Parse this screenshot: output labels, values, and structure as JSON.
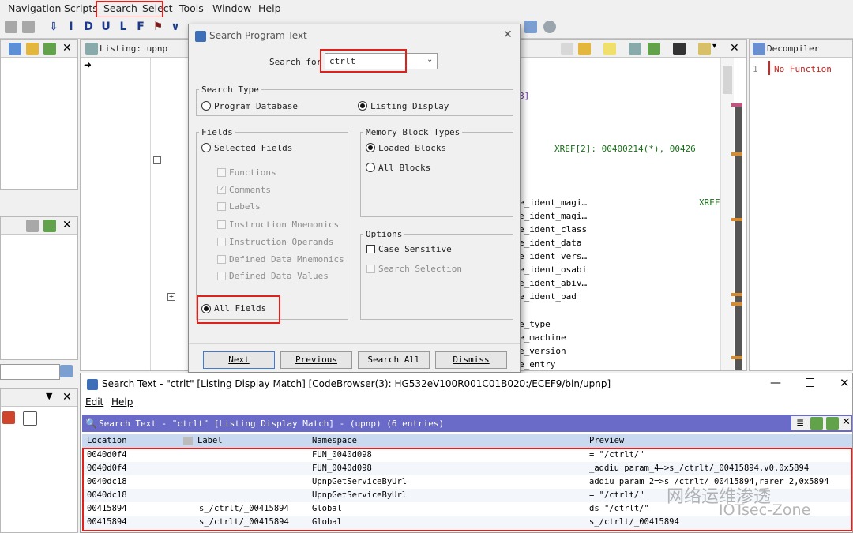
{
  "menu": {
    "items": [
      "Navigation",
      "Scripts",
      "Search",
      "Select",
      "Tools",
      "Window",
      "Help"
    ]
  },
  "toolbar": {
    "letters": [
      "I",
      "D",
      "U",
      "L",
      "F"
    ]
  },
  "listing": {
    "title": "Listing:  upnp",
    "lines": [
      {
        "text": "8]"
      },
      {
        "text": "XREF[2]:     00400214(*), 00426"
      },
      {
        "text": "e_ident_magi…"
      },
      {
        "text": "XREF"
      },
      {
        "text": "e_ident_magi…"
      },
      {
        "text": "e_ident_class"
      },
      {
        "text": "e_ident_data"
      },
      {
        "text": "e_ident_vers…"
      },
      {
        "text": "e_ident_osabi"
      },
      {
        "text": "e_ident_abiv…"
      },
      {
        "text": "e_ident_pad"
      },
      {
        "text": "e_type"
      },
      {
        "text": "e_machine"
      },
      {
        "text": "e_version"
      },
      {
        "text": "e_entry"
      }
    ]
  },
  "decompiler": {
    "title": "Decompiler",
    "line_no": "1",
    "text": "No Function"
  },
  "dialog": {
    "title": "Search Program Text",
    "search_for_label": "Search for",
    "search_value": "ctrlt",
    "search_type": {
      "title": "Search Type",
      "program_database": "Program Database",
      "listing_display": "Listing Display"
    },
    "fields": {
      "title": "Fields",
      "selected_fields": "Selected Fields",
      "functions": "Functions",
      "comments": "Comments",
      "labels": "Labels",
      "instruction_mnemonics": "Instruction Mnemonics",
      "instruction_operands": "Instruction Operands",
      "defined_data_mnemonics": "Defined Data Mnemonics",
      "defined_data_values": "Defined Data Values",
      "all_fields": "All Fields"
    },
    "memory_block_types": {
      "title": "Memory Block Types",
      "loaded_blocks": "Loaded Blocks",
      "all_blocks": "All Blocks"
    },
    "options": {
      "title": "Options",
      "case_sensitive": "Case Sensitive",
      "search_selection": "Search Selection"
    },
    "buttons": {
      "next": "Next",
      "previous": "Previous",
      "search_all": "Search All",
      "dismiss": "Dismiss"
    }
  },
  "results": {
    "window_title": "Search Text - \"ctrlt\"  [Listing Display Match] [CodeBrowser(3): HG532eV100R001C01B020:/ECEF9/bin/upnp]",
    "menu": {
      "edit": "Edit",
      "help": "Help"
    },
    "panel_title": "Search Text - \"ctrlt\"  [Listing Display Match] - (upnp)      (6 entries)",
    "columns": [
      "Location",
      "Label",
      "Namespace",
      "Preview"
    ],
    "rows": [
      {
        "location": "0040d0f4",
        "label": "",
        "namespace": "FUN_0040d098",
        "preview": "= \"/ctrlt/\""
      },
      {
        "location": "0040d0f4",
        "label": "",
        "namespace": "FUN_0040d098",
        "preview": "_addiu param_4=>s_/ctrlt/_00415894,v0,0x5894"
      },
      {
        "location": "0040dc18",
        "label": "",
        "namespace": "UpnpGetServiceByUrl",
        "preview": "addiu param_2=>s_/ctrlt/_00415894,rarer_2,0x5894"
      },
      {
        "location": "0040dc18",
        "label": "",
        "namespace": "UpnpGetServiceByUrl",
        "preview": "= \"/ctrlt/\""
      },
      {
        "location": "00415894",
        "label": "s_/ctrlt/_00415894",
        "namespace": "Global",
        "preview": "ds \"/ctrlt/\""
      },
      {
        "location": "00415894",
        "label": "s_/ctrlt/_00415894",
        "namespace": "Global",
        "preview": "s_/ctrlt/_00415894"
      }
    ]
  },
  "watermark": {
    "line1": "网络运维渗透",
    "line2": "IOTsec-Zone"
  },
  "colors": {
    "highlight_red": "#e0211b",
    "results_header_bg": "#6a6ac8",
    "column_header_bg": "#c9d9ef"
  }
}
